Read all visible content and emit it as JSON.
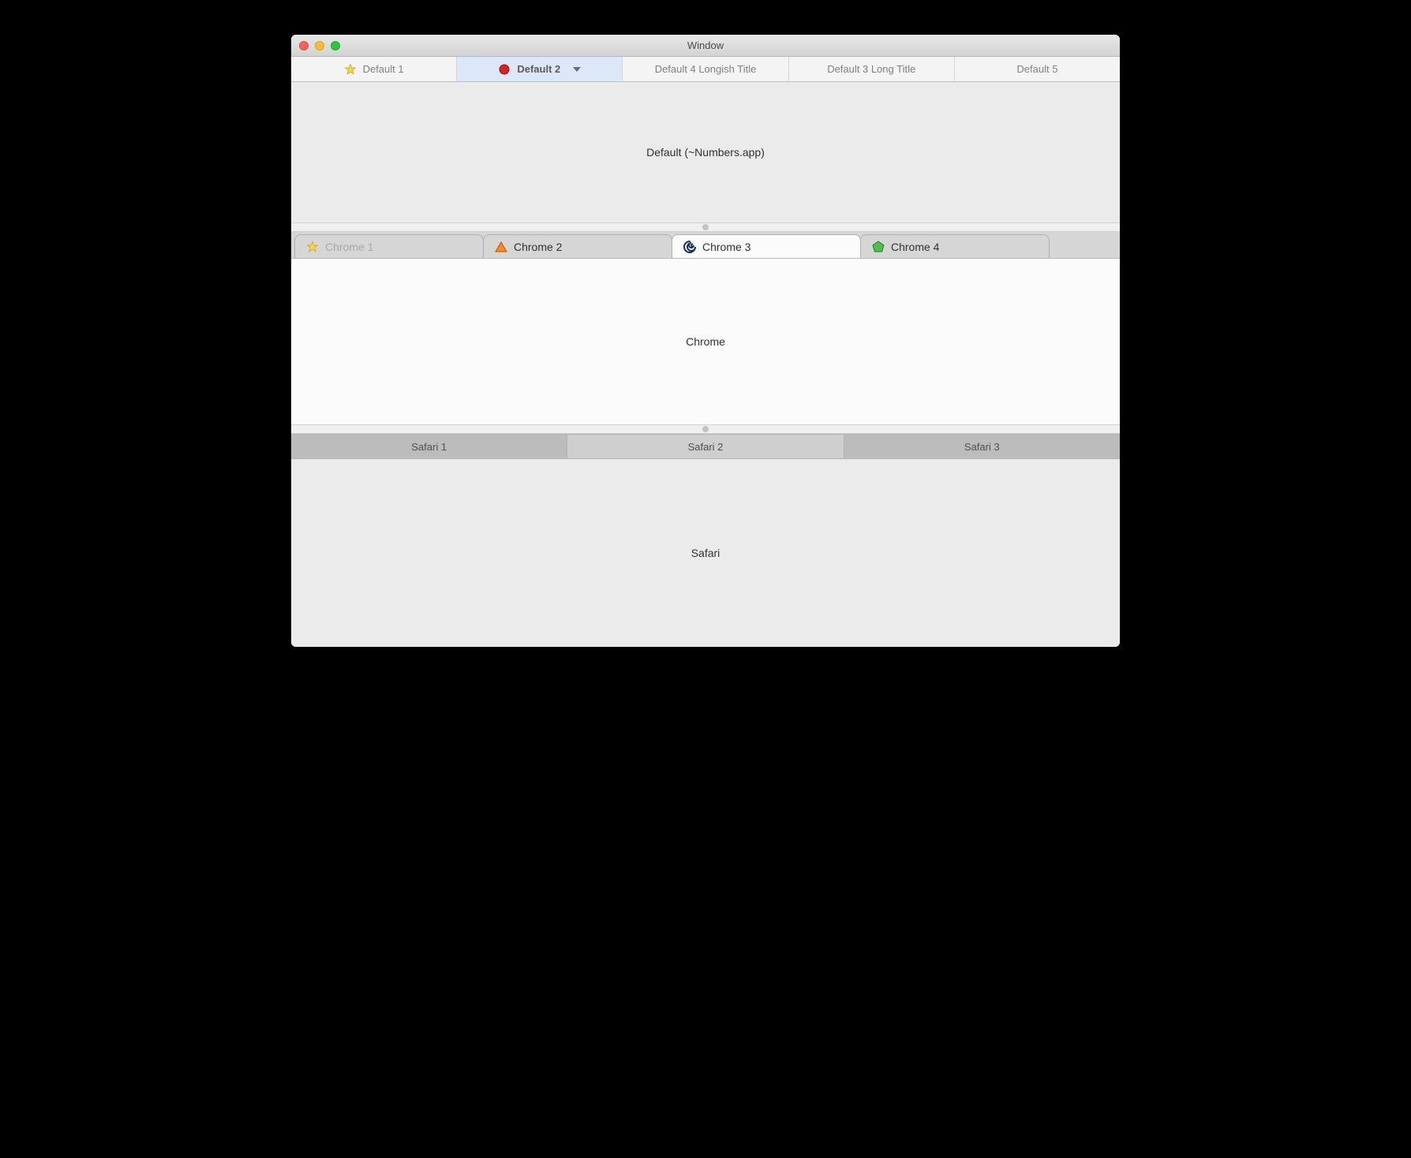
{
  "window": {
    "title": "Window"
  },
  "default_tabs": {
    "panel_label": "Default (~Numbers.app)",
    "items": [
      {
        "label": "Default 1",
        "icon": "star-icon"
      },
      {
        "label": "Default 2",
        "icon": "circle-red-icon",
        "active": true,
        "has_menu": true
      },
      {
        "label": "Default 4 Longish Title"
      },
      {
        "label": "Default 3 Long Title"
      },
      {
        "label": "Default 5"
      }
    ]
  },
  "chrome_tabs": {
    "panel_label": "Chrome",
    "items": [
      {
        "label": "Chrome 1",
        "icon": "star-icon",
        "disabled": true
      },
      {
        "label": "Chrome 2",
        "icon": "triangle-orange-icon"
      },
      {
        "label": "Chrome 3",
        "icon": "spiral-icon",
        "active": true
      },
      {
        "label": "Chrome 4",
        "icon": "pentagon-green-icon"
      }
    ]
  },
  "safari_tabs": {
    "panel_label": "Safari",
    "items": [
      {
        "label": "Safari 1"
      },
      {
        "label": "Safari 2",
        "active": true
      },
      {
        "label": "Safari 3"
      }
    ]
  }
}
